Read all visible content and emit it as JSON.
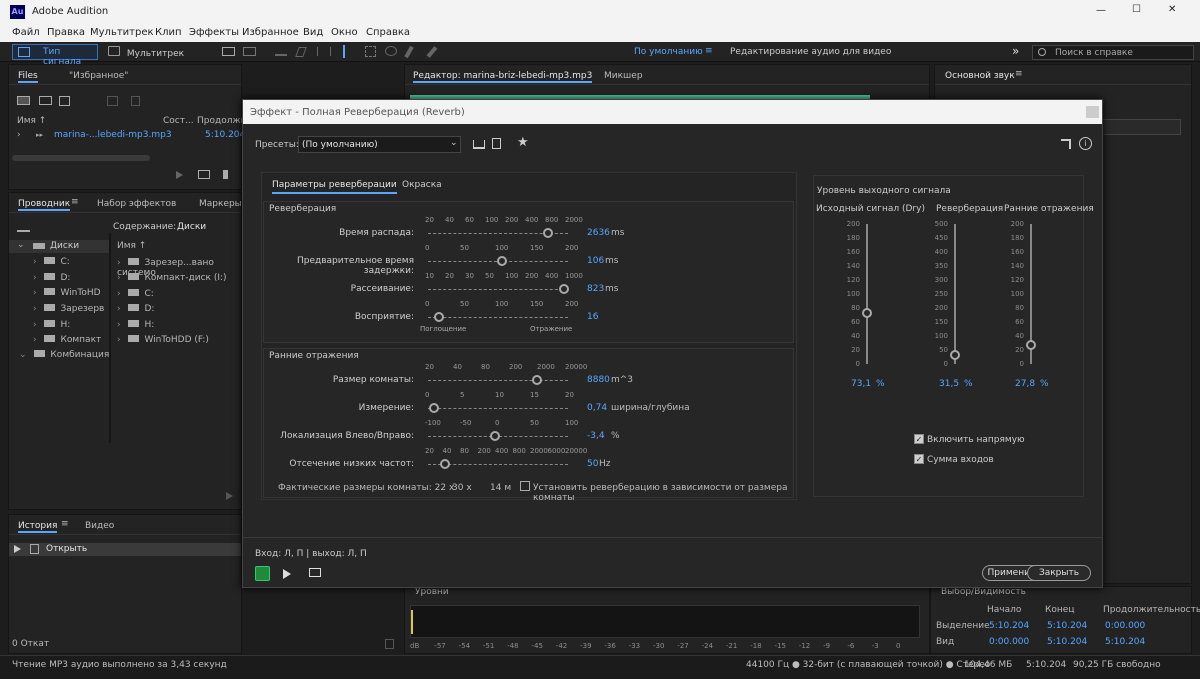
{
  "app": {
    "title": "Adobe Audition",
    "logo": "Au"
  },
  "window_controls": {
    "minimize": "—",
    "maximize": "☐",
    "close": "✕"
  },
  "menu": [
    "Файл",
    "Правка",
    "Мультитрек",
    "Клип",
    "Эффекты",
    "Избранное",
    "Вид",
    "Окно",
    "Справка"
  ],
  "toolbar": {
    "waveform_tab": "Тип сигнала",
    "multitrack_tab": "Мультитрек",
    "workspace_default": "По умолчанию",
    "workspace_edit": "Редактирование аудио для видео",
    "help_search_placeholder": "Поиск в справке",
    "more": "»"
  },
  "files_panel": {
    "tab_files": "Files",
    "tab_favorites": "\"Избранное\"",
    "col_name": "Имя ↑",
    "col_state": "Сост...",
    "col_duration": "Продолжит",
    "file_name": "marina-...lebedi-mp3.mp3",
    "file_duration": "5:10.204"
  },
  "explorer_panel": {
    "tab_explorer": "Проводник",
    "tab_effects": "Набор эффектов",
    "tab_markers": "Маркеры",
    "content_label": "Содержание:",
    "content_value": "Диски",
    "tree_root": "Диски",
    "tree": [
      "C:",
      "D:",
      "WinToHD",
      "Зарезерв",
      "H:",
      "Компакт",
      "Комбинация"
    ],
    "col_name": "Имя ↑",
    "list": [
      "Зарезер...вано системо",
      "Компакт-диск (I:)",
      "C:",
      "D:",
      "H:",
      "WinToHDD (F:)"
    ]
  },
  "history_panel": {
    "tab_history": "История",
    "tab_video": "Видео",
    "item": "Открыть",
    "undo_count": "0 Откат"
  },
  "editor": {
    "tab_editor": "Редактор: marina-briz-lebedi-mp3.mp3",
    "tab_mixer": "Микшер"
  },
  "essential_sound": {
    "title": "Основной звук"
  },
  "levels": {
    "title": "Уровни",
    "scale": [
      "dB",
      "-57",
      "-54",
      "-51",
      "-48",
      "-45",
      "-42",
      "-39",
      "-36",
      "-33",
      "-30",
      "-27",
      "-24",
      "-21",
      "-18",
      "-15",
      "-12",
      "-9",
      "-6",
      "-3",
      "0"
    ]
  },
  "selection": {
    "title": "Выбор/Видимость",
    "col_start": "Начало",
    "col_end": "Конец",
    "col_duration": "Продолжительность",
    "row_selection": "Выделение",
    "row_view": "Вид",
    "sel_start": "5:10.204",
    "sel_end": "5:10.204",
    "sel_duration": "0:00.000",
    "view_start": "0:00.000",
    "view_end": "5:10.204",
    "view_duration": "5:10.204"
  },
  "status": {
    "message": "Чтение MP3 аудио выполнено за 3,43 секунд",
    "format": "44100 Гц ● 32-бит (с плавающей точкой) ● Стерео",
    "size": "104,46 МБ",
    "duration": "5:10.204",
    "free": "90,25 ГБ свободно"
  },
  "dialog": {
    "title": "Эффект - Полная Реверберация (Reverb)",
    "presets_label": "Пресеты:",
    "preset_value": "(По умолчанию)",
    "tab_params": "Параметры реверберации",
    "tab_coloring": "Окраска",
    "reverb_section": "Реверберация",
    "early_section": "Ранние отражения",
    "sliders_reverb": [
      {
        "label": "Время распада:",
        "ticks": [
          "20",
          "40",
          "60",
          "100",
          "200",
          "400",
          "800",
          "2000"
        ],
        "value": "2636",
        "unit": "ms",
        "pos": 0.86
      },
      {
        "label": "Предварительное время задержки:",
        "ticks": [
          "0",
          "50",
          "100",
          "150",
          "200"
        ],
        "value": "106",
        "unit": "ms",
        "pos": 0.53
      },
      {
        "label": "Рассеивание:",
        "ticks": [
          "10",
          "20",
          "30",
          "50",
          "100",
          "200",
          "400",
          "1000"
        ],
        "value": "823",
        "unit": "ms",
        "pos": 0.97
      },
      {
        "label": "Восприятие:",
        "ticks": [
          "0",
          "50",
          "100",
          "150",
          "200"
        ],
        "value": "16",
        "unit": "",
        "pos": 0.08
      }
    ],
    "perception_left": "Поглощение",
    "perception_right": "Отражение",
    "sliders_early": [
      {
        "label": "Размер комнаты:",
        "ticks": [
          "20",
          "40",
          "80",
          "200",
          "2000",
          "20000"
        ],
        "value": "8880",
        "unit": "m^3",
        "pos": 0.78
      },
      {
        "label": "Измерение:",
        "ticks": [
          "0",
          "5",
          "10",
          "15",
          "20"
        ],
        "value": "0,74",
        "unit": "ширина/глубина",
        "pos": 0.04
      },
      {
        "label": "Локализация Влево/Вправо:",
        "ticks": [
          "-100",
          "-50",
          "0",
          "50",
          "100"
        ],
        "value": "-3,4",
        "unit": "%",
        "pos": 0.48
      },
      {
        "label": "Отсечение низких частот:",
        "ticks": [
          "20",
          "40",
          "80",
          "200",
          "400",
          "800",
          "2000",
          "6000",
          "20000"
        ],
        "value": "50",
        "unit": "Hz",
        "pos": 0.12
      }
    ],
    "room_size_text": "Фактические размеры комнаты: 22 х",
    "room_dim2": "30 х",
    "room_dim3": "14 м",
    "room_checkbox": "Установить реверберацию в зависимости от размера комнаты",
    "output_title": "Уровень выходного сигнала",
    "meters": [
      {
        "label": "Исходный сигнал (Dry)",
        "scale": [
          "200",
          "180",
          "160",
          "140",
          "120",
          "100",
          "80",
          "60",
          "40",
          "20",
          "0"
        ],
        "value": "73,1",
        "unit": "%",
        "level": 0.365
      },
      {
        "label": "Реверберация",
        "scale": [
          "500",
          "450",
          "400",
          "350",
          "300",
          "250",
          "200",
          "150",
          "100",
          "50",
          "0"
        ],
        "value": "31,5",
        "unit": "%",
        "level": 0.063
      },
      {
        "label": "Ранние отражения",
        "scale": [
          "200",
          "180",
          "160",
          "140",
          "120",
          "100",
          "80",
          "60",
          "40",
          "20",
          "0"
        ],
        "value": "27,8",
        "unit": "%",
        "level": 0.139
      }
    ],
    "include_direct": "Включить напрямую",
    "sum_inputs": "Сумма входов",
    "io_label": "Вход: Л, П | выход: Л, П",
    "apply": "Применить",
    "close": "Закрыть"
  }
}
